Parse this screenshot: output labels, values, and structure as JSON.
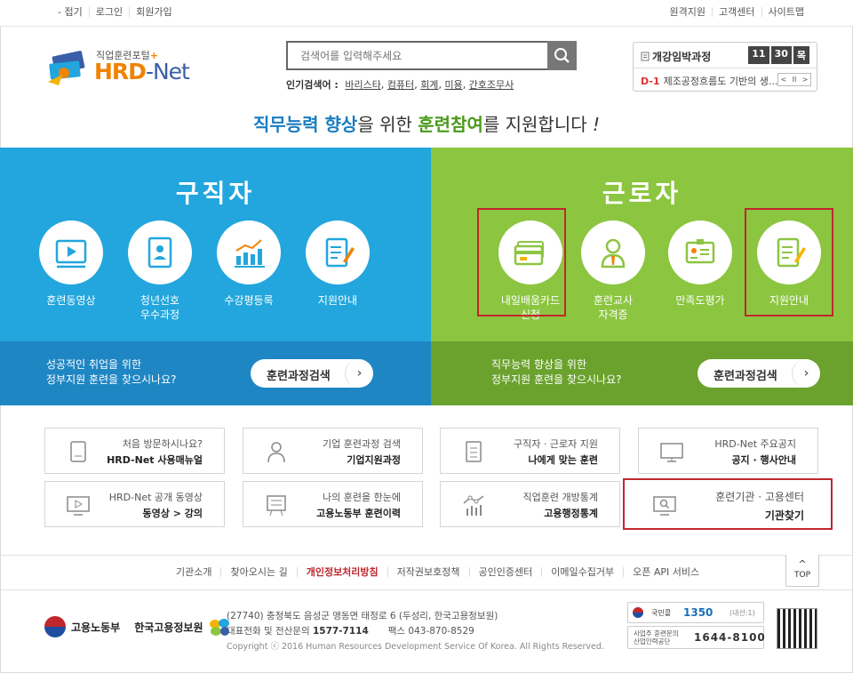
{
  "util": {
    "left": [
      "- 접기",
      "로그인",
      "회원가입"
    ],
    "right": [
      "원격지원",
      "고객센터",
      "사이트맵"
    ]
  },
  "logo": {
    "sub": "직업훈련포털",
    "plus": "+",
    "main1": "HRD",
    "main2": "-Net"
  },
  "search": {
    "placeholder": "검색어를 입력해주세요"
  },
  "popular": {
    "label": "인기검색어 :",
    "keywords": [
      "바리스타",
      "컴퓨터",
      "회계",
      "미용",
      "간호조무사"
    ]
  },
  "open_course": {
    "title": "개강임박과정",
    "date": [
      "11",
      "30",
      "목"
    ],
    "dday": "D-1",
    "item": "제조공정흐름도 기반의 생...",
    "controls": [
      "<",
      "II",
      ">"
    ]
  },
  "headline": {
    "p1": "직무능력 향상",
    "p2": "을 위한 ",
    "p3": "훈련참여",
    "p4": "를 지원합니다 ",
    "p5": "!"
  },
  "jobseeker": {
    "title": "구직자",
    "items": [
      {
        "l1": "훈련동영상",
        "l2": ""
      },
      {
        "l1": "청년선호",
        "l2": "우수과정"
      },
      {
        "l1": "수강평등록",
        "l2": ""
      },
      {
        "l1": "지원안내",
        "l2": ""
      }
    ],
    "bottom_l1": "성공적인 취업을 위한",
    "bottom_l2": "정부지원 훈련을 찾으시나요?",
    "button": "훈련과정검색",
    "arrow": "›"
  },
  "worker": {
    "title": "근로자",
    "items": [
      {
        "l1": "내일배움카드",
        "l2": "신청"
      },
      {
        "l1": "훈련교사",
        "l2": "자격증"
      },
      {
        "l1": "만족도평가",
        "l2": ""
      },
      {
        "l1": "지원안내",
        "l2": ""
      }
    ],
    "bottom_l1": "직무능력 향상을 위한",
    "bottom_l2": "정부지원 훈련을 찾으시나요?",
    "button": "훈련과정검색",
    "arrow": "›"
  },
  "quicklinks": [
    {
      "sub": "처음 방문하시나요?",
      "main": "HRD-Net 사용매뉴얼"
    },
    {
      "sub": "기업 훈련과정 검색",
      "main": "기업지원과정"
    },
    {
      "sub": "구직자 · 근로자 지원",
      "main": "나에게 맞는 훈련"
    },
    {
      "sub": "HRD-Net 주요공지",
      "main": "공지 · 행사안내"
    },
    {
      "sub": "HRD-Net 공개 동영상",
      "main": "동영상 > 강의"
    },
    {
      "sub": "나의 훈련을 한눈에",
      "main": "고용노동부 훈련이력"
    },
    {
      "sub": "직업훈련 개방통계",
      "main": "고용행정통계"
    },
    {
      "sub": "훈련기관 · 고용센터",
      "main": "기관찾기"
    }
  ],
  "footer": {
    "links": [
      "기관소개",
      "찾아오시는 길",
      "개인정보처리방침",
      "저작권보호정책",
      "공인인증센터",
      "이메일수집거부",
      "오픈 API 서비스"
    ],
    "top_arrow": "^",
    "top_label": "TOP",
    "org1": "고용노동부",
    "org2": "한국고용정보원",
    "addr1": "(27740) 충청북도 음성군 맹동면 태정로 6 (두성리, 한국고용정보원)",
    "addr2_pre": "대표전화 및 전산문의 ",
    "addr2_num": "1577-7114",
    "addr2_fax": "팩스 043-870-8529",
    "copyright": "Copyright ⓒ 2016 Human Resources Development Service Of Korea. All Rights Reserved.",
    "call1_pre": "국민콜",
    "call1_num": "1350",
    "call1_post": "(내선:1)",
    "call2_pre1": "사업주 훈련문의",
    "call2_pre2": "산업인력공단",
    "call2_num": "1644-8100"
  },
  "colors": {
    "blue": "#22a6dd",
    "blue_dark": "#1f86c4",
    "green": "#8cc540",
    "green_dark": "#6ba22e",
    "orange": "#f08300",
    "highlight": "#c0272d"
  }
}
